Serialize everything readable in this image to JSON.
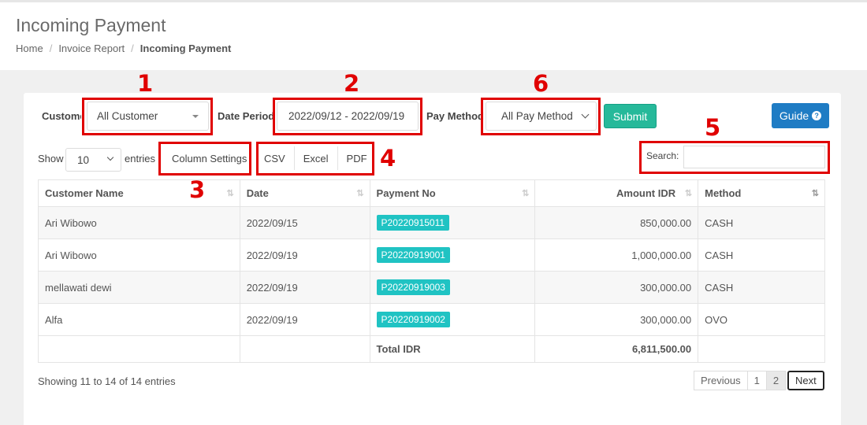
{
  "header": {
    "title": "Incoming Payment",
    "breadcrumb": [
      "Home",
      "Invoice Report",
      "Incoming Payment"
    ]
  },
  "filters": {
    "customer_label": "Customer",
    "customer_value": "All Customer",
    "date_label": "Date Period",
    "date_value": "2022/09/12 - 2022/09/19",
    "pay_label": "Pay Method",
    "pay_value": "All Pay Method",
    "submit_label": "Submit",
    "guide_label": "Guide"
  },
  "controls": {
    "show_label": "Show",
    "entries_value": "10",
    "entries_label": "entries",
    "column_settings": "Column Settings",
    "export": [
      "CSV",
      "Excel",
      "PDF"
    ],
    "search_label": "Search:",
    "search_value": ""
  },
  "markers": [
    "1",
    "2",
    "3",
    "4",
    "5",
    "6"
  ],
  "table": {
    "columns": [
      "Customer Name",
      "Date",
      "Payment No",
      "Amount IDR",
      "Method"
    ],
    "rows": [
      {
        "customer": "Ari Wibowo",
        "date": "2022/09/15",
        "payment_no": "P20220915011",
        "amount": "850,000.00",
        "method": "CASH"
      },
      {
        "customer": "Ari Wibowo",
        "date": "2022/09/19",
        "payment_no": "P20220919001",
        "amount": "1,000,000.00",
        "method": "CASH"
      },
      {
        "customer": "mellawati dewi",
        "date": "2022/09/19",
        "payment_no": "P20220919003",
        "amount": "300,000.00",
        "method": "CASH"
      },
      {
        "customer": "Alfa",
        "date": "2022/09/19",
        "payment_no": "P20220919002",
        "amount": "300,000.00",
        "method": "OVO"
      }
    ],
    "total_label": "Total IDR",
    "total_value": "6,811,500.00"
  },
  "footer": {
    "info": "Showing 11 to 14 of 14 entries",
    "pagination": [
      "Previous",
      "1",
      "2",
      "Next"
    ]
  },
  "colors": {
    "accent_red": "#e00000",
    "submit_green": "#26b99a",
    "guide_blue": "#1f7cc4",
    "badge_teal": "#20c3c3"
  }
}
